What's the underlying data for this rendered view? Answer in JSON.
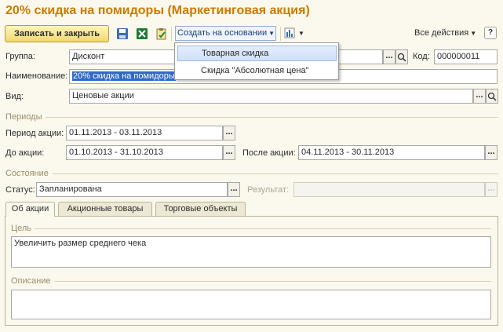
{
  "title": "20% скидка на помидоры (Маркетинговая акция)",
  "toolbar": {
    "save_close_label": "Записать и закрыть",
    "create_based_label": "Создать на основании",
    "all_actions_label": "Все действия",
    "help_label": "?"
  },
  "dropdown": {
    "items": [
      {
        "label": "Товарная скидка"
      },
      {
        "label": "Скидка \"Абсолютная цена\""
      }
    ]
  },
  "form": {
    "group_label": "Группа:",
    "group_value": "Дисконт",
    "code_label": "Код:",
    "code_value": "000000011",
    "name_label": "Наименование:",
    "name_value": "20% скидка на помидоры",
    "kind_label": "Вид:",
    "kind_value": "Ценовые акции"
  },
  "periods": {
    "section_label": "Периоды",
    "action_period_label": "Период акции:",
    "action_period_value": "01.11.2013 - 03.11.2013",
    "before_label": "До акции:",
    "before_value": "01.10.2013 - 31.10.2013",
    "after_label": "После акции:",
    "after_value": "04.11.2013 - 30.11.2013"
  },
  "state": {
    "section_label": "Состояние",
    "status_label": "Статус:",
    "status_value": "Запланирована",
    "result_label": "Результат:",
    "result_value": ""
  },
  "tabs": [
    {
      "label": "Об акции"
    },
    {
      "label": "Акционные товары"
    },
    {
      "label": "Торговые объекты"
    }
  ],
  "about": {
    "goal_label": "Цель",
    "goal_value": "Увеличить размер среднего чека",
    "description_label": "Описание",
    "description_value": ""
  },
  "colors": {
    "title": "#cc7a00",
    "background": "#fbf9ed",
    "selection": "#3169c6",
    "button_gradient_bottom": "#f1d86c"
  }
}
